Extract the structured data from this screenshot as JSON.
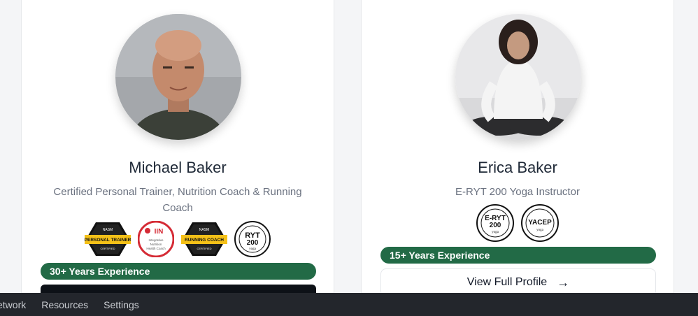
{
  "trainers": [
    {
      "name": "Michael Baker",
      "title": "Certified Personal Trainer, Nutrition Coach & Running Coach",
      "badges": [
        {
          "icon": "personal-trainer-badge-icon",
          "text": "PERSONAL TRAINER"
        },
        {
          "icon": "iin-health-coach-badge-icon",
          "text": "IIN"
        },
        {
          "icon": "running-coach-badge-icon",
          "text": "RUNNING COACH"
        },
        {
          "icon": "ryt-200-badge-icon",
          "text": "RYT 200"
        }
      ],
      "experience": "30+ Years Experience"
    },
    {
      "name": "Erica Baker",
      "title": "E-RYT 200 Yoga Instructor",
      "badges": [
        {
          "icon": "e-ryt-200-badge-icon",
          "text": "E-RYT 200"
        },
        {
          "icon": "yacep-badge-icon",
          "text": "YACEP"
        }
      ],
      "experience": "15+ Years Experience",
      "cta": "View Full Profile",
      "cta_icon": "arrow-right-icon"
    }
  ],
  "bottom_bar": {
    "items": [
      "etwork",
      "Resources",
      "Settings"
    ]
  },
  "colors": {
    "experience_bg": "#226a46",
    "bottom_bar_bg": "#23262c"
  }
}
